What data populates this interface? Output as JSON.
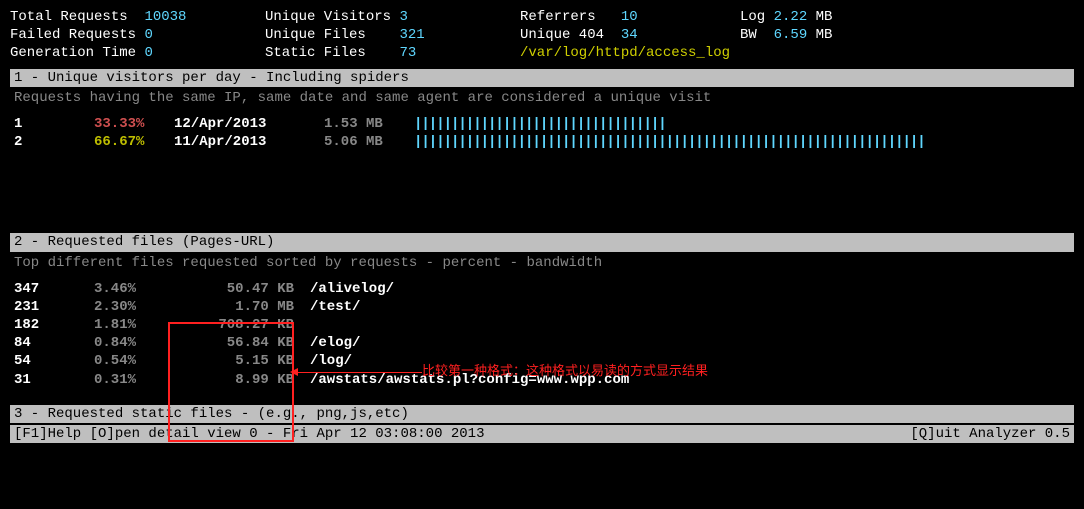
{
  "stats": {
    "total_requests_label": "Total Requests",
    "total_requests": "10038",
    "failed_requests_label": "Failed Requests",
    "failed_requests": "0",
    "generation_time_label": "Generation Time",
    "generation_time": "0",
    "unique_visitors_label": "Unique Visitors",
    "unique_visitors": "3",
    "unique_files_label": "Unique Files",
    "unique_files": "321",
    "static_files_label": "Static Files",
    "static_files": "73",
    "referrers_label": "Referrers",
    "referrers": "10",
    "unique_404_label": "Unique 404",
    "unique_404": "34",
    "log_label": "Log",
    "log_value": "2.22",
    "log_unit": "MB",
    "bw_label": "BW",
    "bw_value": "6.59",
    "bw_unit": "MB",
    "log_path": "/var/log/httpd/access_log"
  },
  "section1": {
    "header": " 1 - Unique visitors per day - Including spiders",
    "subtitle": "Requests having the same IP, same date and same agent are considered a unique visit",
    "rows": [
      {
        "idx": "1",
        "pct": "33.33%",
        "pct_class": "red",
        "date": "12/Apr/2013",
        "size": "1.53 MB",
        "bar": "||||||||||||||||||||||||||||||||||"
      },
      {
        "idx": "2",
        "pct": "66.67%",
        "pct_class": "yel",
        "date": "11/Apr/2013",
        "size": "5.06 MB",
        "bar": "|||||||||||||||||||||||||||||||||||||||||||||||||||||||||||||||||||||"
      }
    ]
  },
  "section2": {
    "header": " 2 - Requested files (Pages-URL)",
    "subtitle": "Top different files requested sorted by requests - percent - bandwidth",
    "rows": [
      {
        "count": "347",
        "pct": "3.46%",
        "size": "50.47 KB",
        "path": "/alivelog/"
      },
      {
        "count": "231",
        "pct": "2.30%",
        "size": "1.70 MB",
        "path": "/test/"
      },
      {
        "count": "182",
        "pct": "1.81%",
        "size": "708.27 KB",
        "path": ""
      },
      {
        "count": "84",
        "pct": "0.84%",
        "size": "56.84 KB",
        "path": "/elog/"
      },
      {
        "count": "54",
        "pct": "0.54%",
        "size": "5.15 KB",
        "path": "/log/"
      },
      {
        "count": "31",
        "pct": "0.31%",
        "size": "8.99 KB",
        "path": "/awstats/awstats.pl?config=www.wpp.com"
      }
    ]
  },
  "section3": {
    "header": " 3 - Requested static files - (e.g., png,js,etc)"
  },
  "annotation": "比较第一种格式：这种格式以易读的方式显示结果",
  "footer": {
    "left": "[F1]Help [O]pen detail view  0 - Fri Apr 12 03:08:00 2013",
    "right": "[Q]uit Analyzer 0.5"
  }
}
